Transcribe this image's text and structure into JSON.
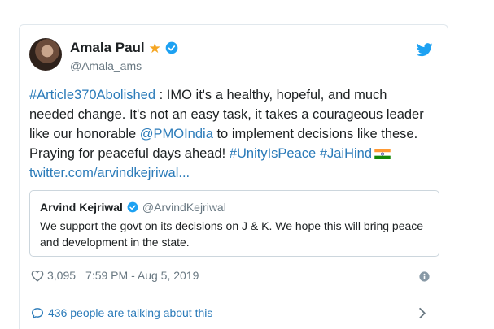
{
  "author": {
    "name": "Amala Paul",
    "handle": "@Amala_ams",
    "badge_icon": "star-icon",
    "verified_icon": "verified-badge-icon"
  },
  "brand": {
    "icon": "twitter-bird-icon",
    "color": "#1da1f2",
    "link_color": "#2b7bb9"
  },
  "tweet": {
    "hashtag_1": "#Article370Abolished",
    "text_1": " : IMO it's a healthy, hopeful, and much needed change. It's not an easy task, it takes a courageous leader like our honorable ",
    "mention": "@PMOIndia",
    "text_2": " to implement decisions like these. Praying for peaceful days ahead! ",
    "hashtag_2": "#UnityIsPeace",
    "hashtag_3": "#JaiHind",
    "flag_icon": "india-flag-icon",
    "link": "twitter.com/arvindkejriwal..."
  },
  "quoted": {
    "name": "Arvind Kejriwal",
    "handle": "@ArvindKejriwal",
    "text": "We support the govt on its decisions on J & K. We hope this will bring peace and development in the state."
  },
  "stats": {
    "likes": "3,095",
    "timestamp": "7:59 PM - Aug 5, 2019"
  },
  "footer": {
    "talking": "436 people are talking about this"
  }
}
